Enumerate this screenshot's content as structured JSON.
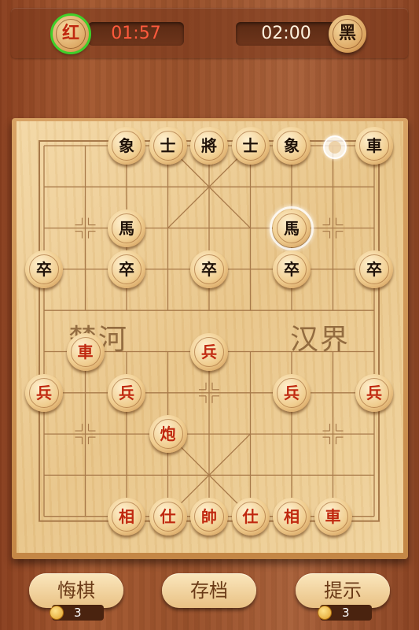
{
  "top": {
    "red_side": {
      "label": "红",
      "timer": "01:57",
      "active": true
    },
    "black_side": {
      "label": "黑",
      "timer": "02:00"
    }
  },
  "board": {
    "river_left": "楚河",
    "river_right": "汉界",
    "pieces": [
      {
        "side": "black",
        "label": "車",
        "col": 8,
        "row": 0
      },
      {
        "side": "black",
        "label": "象",
        "col": 2,
        "row": 0
      },
      {
        "side": "black",
        "label": "士",
        "col": 3,
        "row": 0
      },
      {
        "side": "black",
        "label": "將",
        "col": 4,
        "row": 0
      },
      {
        "side": "black",
        "label": "士",
        "col": 5,
        "row": 0
      },
      {
        "side": "black",
        "label": "象",
        "col": 6,
        "row": 0
      },
      {
        "side": "black",
        "label": "馬",
        "col": 2,
        "row": 2
      },
      {
        "side": "black",
        "label": "馬",
        "col": 6,
        "row": 2,
        "selected": true
      },
      {
        "side": "black",
        "label": "卒",
        "col": 0,
        "row": 3
      },
      {
        "side": "black",
        "label": "卒",
        "col": 2,
        "row": 3
      },
      {
        "side": "black",
        "label": "卒",
        "col": 4,
        "row": 3
      },
      {
        "side": "black",
        "label": "卒",
        "col": 6,
        "row": 3
      },
      {
        "side": "black",
        "label": "卒",
        "col": 8,
        "row": 3
      },
      {
        "side": "red",
        "label": "車",
        "col": 1,
        "row": 5
      },
      {
        "side": "red",
        "label": "兵",
        "col": 4,
        "row": 5
      },
      {
        "side": "red",
        "label": "兵",
        "col": 0,
        "row": 6
      },
      {
        "side": "red",
        "label": "兵",
        "col": 2,
        "row": 6
      },
      {
        "side": "red",
        "label": "兵",
        "col": 6,
        "row": 6
      },
      {
        "side": "red",
        "label": "兵",
        "col": 8,
        "row": 6
      },
      {
        "side": "red",
        "label": "炮",
        "col": 3,
        "row": 7
      },
      {
        "side": "red",
        "label": "相",
        "col": 2,
        "row": 9
      },
      {
        "side": "red",
        "label": "仕",
        "col": 3,
        "row": 9
      },
      {
        "side": "red",
        "label": "帥",
        "col": 4,
        "row": 9
      },
      {
        "side": "red",
        "label": "仕",
        "col": 5,
        "row": 9
      },
      {
        "side": "red",
        "label": "相",
        "col": 6,
        "row": 9
      },
      {
        "side": "red",
        "label": "車",
        "col": 7,
        "row": 9
      }
    ],
    "move_hint": {
      "col": 7,
      "row": 0
    }
  },
  "buttons": {
    "undo": {
      "label": "悔棋",
      "count": "3"
    },
    "save": {
      "label": "存档"
    },
    "hint": {
      "label": "提示",
      "count": "3"
    }
  }
}
